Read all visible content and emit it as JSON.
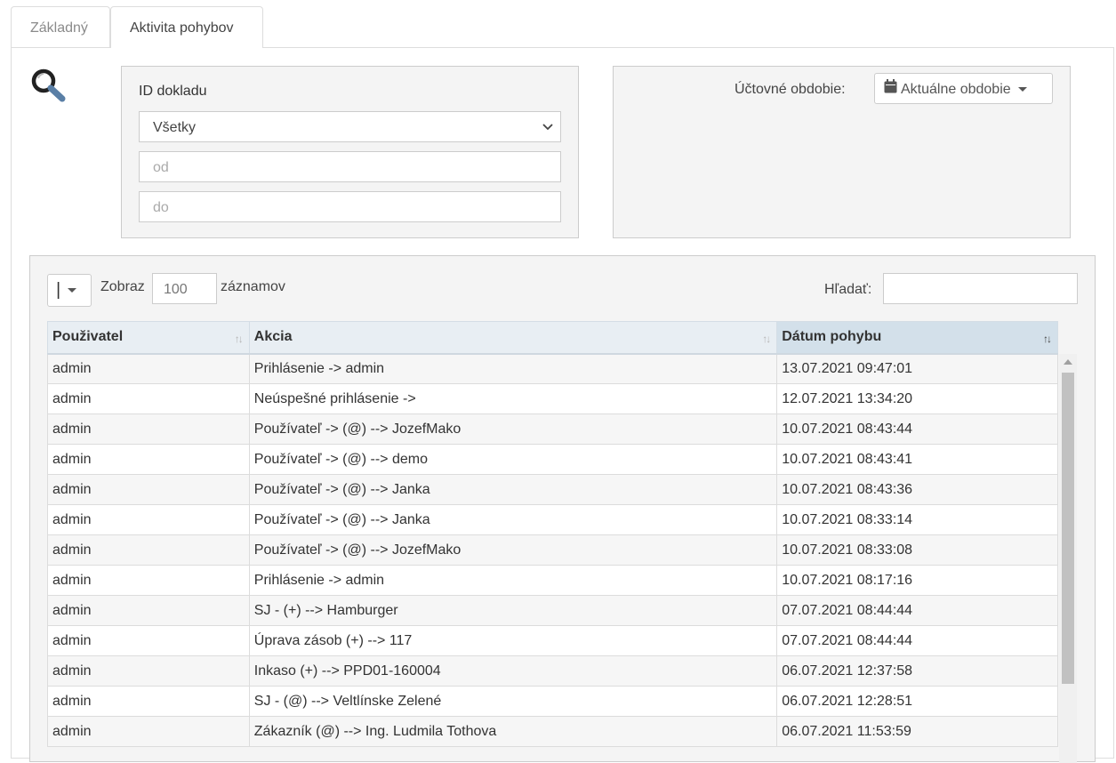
{
  "tabs": [
    {
      "label": "Základný",
      "active": false
    },
    {
      "label": "Aktivita pohybov",
      "active": true
    }
  ],
  "filters": {
    "search_icon": "magnifier-icon",
    "doc_id_label": "ID dokladu",
    "doc_id_select_value": "Všetky",
    "from_placeholder": "od",
    "to_placeholder": "do",
    "period_label": "Účtovné obdobie:",
    "period_icon": "calendar-icon",
    "period_value": "Aktuálne obdobie"
  },
  "table_controls": {
    "column_toggle_label": "|",
    "show_label": "Zobraz",
    "page_length": "100",
    "records_label": "záznamov",
    "search_label": "Hľadať:",
    "search_value": ""
  },
  "table": {
    "columns": [
      "Použivatel",
      "Akcia",
      "Dátum pohybu"
    ],
    "sorted_column": "Dátum pohybu",
    "rows": [
      [
        "admin",
        "Prihlásenie -> admin",
        "13.07.2021 09:47:01"
      ],
      [
        "admin",
        "Neúspešné prihlásenie ->",
        "12.07.2021 13:34:20"
      ],
      [
        "admin",
        "Používateľ -> (@) --> JozefMako",
        "10.07.2021 08:43:44"
      ],
      [
        "admin",
        "Používateľ -> (@) --> demo",
        "10.07.2021 08:43:41"
      ],
      [
        "admin",
        "Používateľ -> (@) --> Janka",
        "10.07.2021 08:43:36"
      ],
      [
        "admin",
        "Používateľ -> (@) --> Janka",
        "10.07.2021 08:33:14"
      ],
      [
        "admin",
        "Používateľ -> (@) --> JozefMako",
        "10.07.2021 08:33:08"
      ],
      [
        "admin",
        "Prihlásenie -> admin",
        "10.07.2021 08:17:16"
      ],
      [
        "admin",
        "SJ - (+) --> Hamburger",
        "07.07.2021 08:44:44"
      ],
      [
        "admin",
        "Úprava zásob (+) --> 117",
        "07.07.2021 08:44:44"
      ],
      [
        "admin",
        "Inkaso (+) --> PPD01-160004",
        "06.07.2021 12:37:58"
      ],
      [
        "admin",
        "SJ - (@) --> Veltlínske Zelené",
        "06.07.2021 12:28:51"
      ],
      [
        "admin",
        "Zákazník (@) --> Ing. Ludmila Tothova",
        "06.07.2021 11:53:59"
      ]
    ]
  }
}
